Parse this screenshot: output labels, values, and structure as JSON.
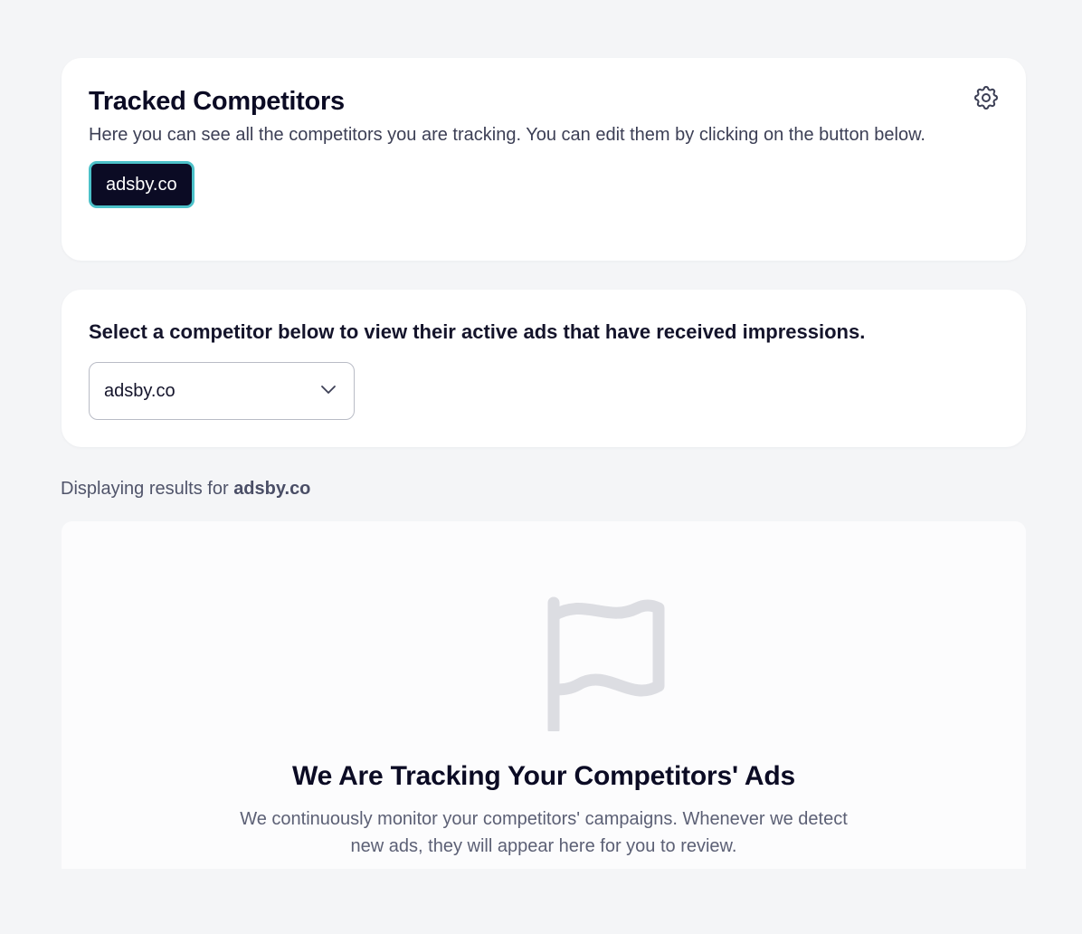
{
  "tracked": {
    "title": "Tracked Competitors",
    "description": "Here you can see all the competitors you are tracking. You can edit them by clicking on the button below.",
    "chips": [
      "adsby.co"
    ],
    "settings_icon": "gear-icon"
  },
  "selector": {
    "heading": "Select a competitor below to view their active ads that have received impressions.",
    "selected_value": "adsby.co",
    "dropdown_icon": "chevron-down-icon"
  },
  "results": {
    "prefix": "Displaying results for",
    "competitor": "adsby.co"
  },
  "empty_state": {
    "icon": "flag-icon",
    "title": "We Are Tracking Your Competitors' Ads",
    "description": "We continuously monitor your competitors' campaigns. Whenever we detect new ads, they will appear here for you to review."
  },
  "colors": {
    "page_background": "#f4f5f7",
    "card_background": "#ffffff",
    "chip_background": "#0b0b24",
    "chip_border": "#4cc1c9",
    "text_primary": "#0b0b24",
    "flag_icon": "#dcdde2"
  }
}
